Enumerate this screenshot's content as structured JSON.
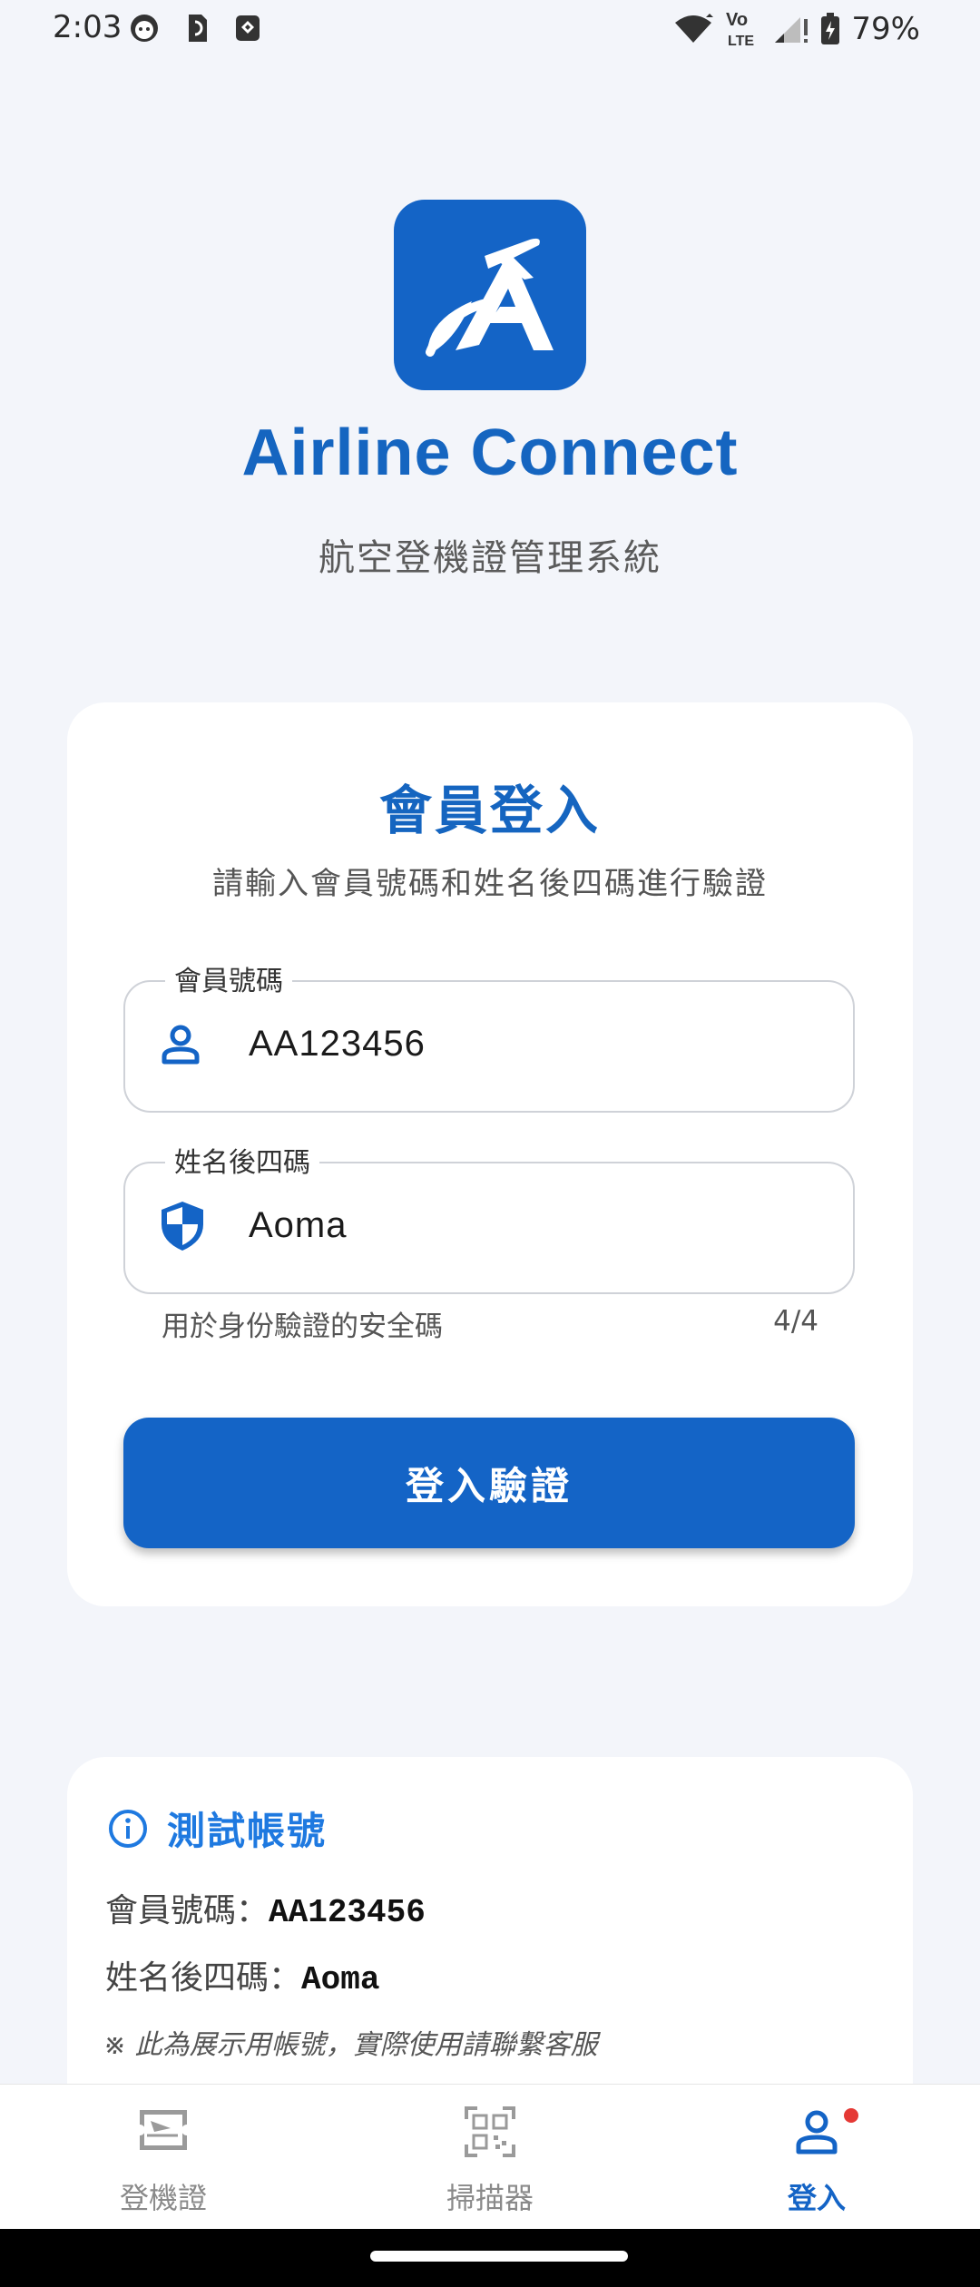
{
  "status_bar": {
    "time": "2:03",
    "battery": "79%",
    "network_badge": "Vo LTE"
  },
  "header": {
    "app_title": "Airline Connect",
    "subtitle": "航空登機證管理系統"
  },
  "login_card": {
    "title": "會員登入",
    "subtitle": "請輸入會員號碼和姓名後四碼進行驗證",
    "member_field": {
      "label": "會員號碼",
      "value": "AA123456",
      "icon": "person-icon"
    },
    "name_field": {
      "label": "姓名後四碼",
      "value": "Aoma",
      "icon": "shield-icon"
    },
    "helper_text": "用於身份驗證的安全碼",
    "counter": "4/4",
    "login_button": "登入驗證"
  },
  "test_account": {
    "title": "測試帳號",
    "member_label": "會員號碼：",
    "member_value": "AA123456",
    "name_label": "姓名後四碼：",
    "name_value": "Aoma",
    "note": "※ 此為展示用帳號，實際使用請聯繫客服"
  },
  "bottom_nav": {
    "items": [
      {
        "label": "登機證",
        "icon": "boarding-pass-icon",
        "active": false
      },
      {
        "label": "掃描器",
        "icon": "qr-scanner-icon",
        "active": false
      },
      {
        "label": "登入",
        "icon": "person-icon",
        "active": true
      }
    ]
  },
  "colors": {
    "primary": "#1464c6",
    "accent_blue": "#1e79e0",
    "inactive": "#8a8a8a",
    "badge": "#e53935",
    "background": "#f3f5fa"
  }
}
